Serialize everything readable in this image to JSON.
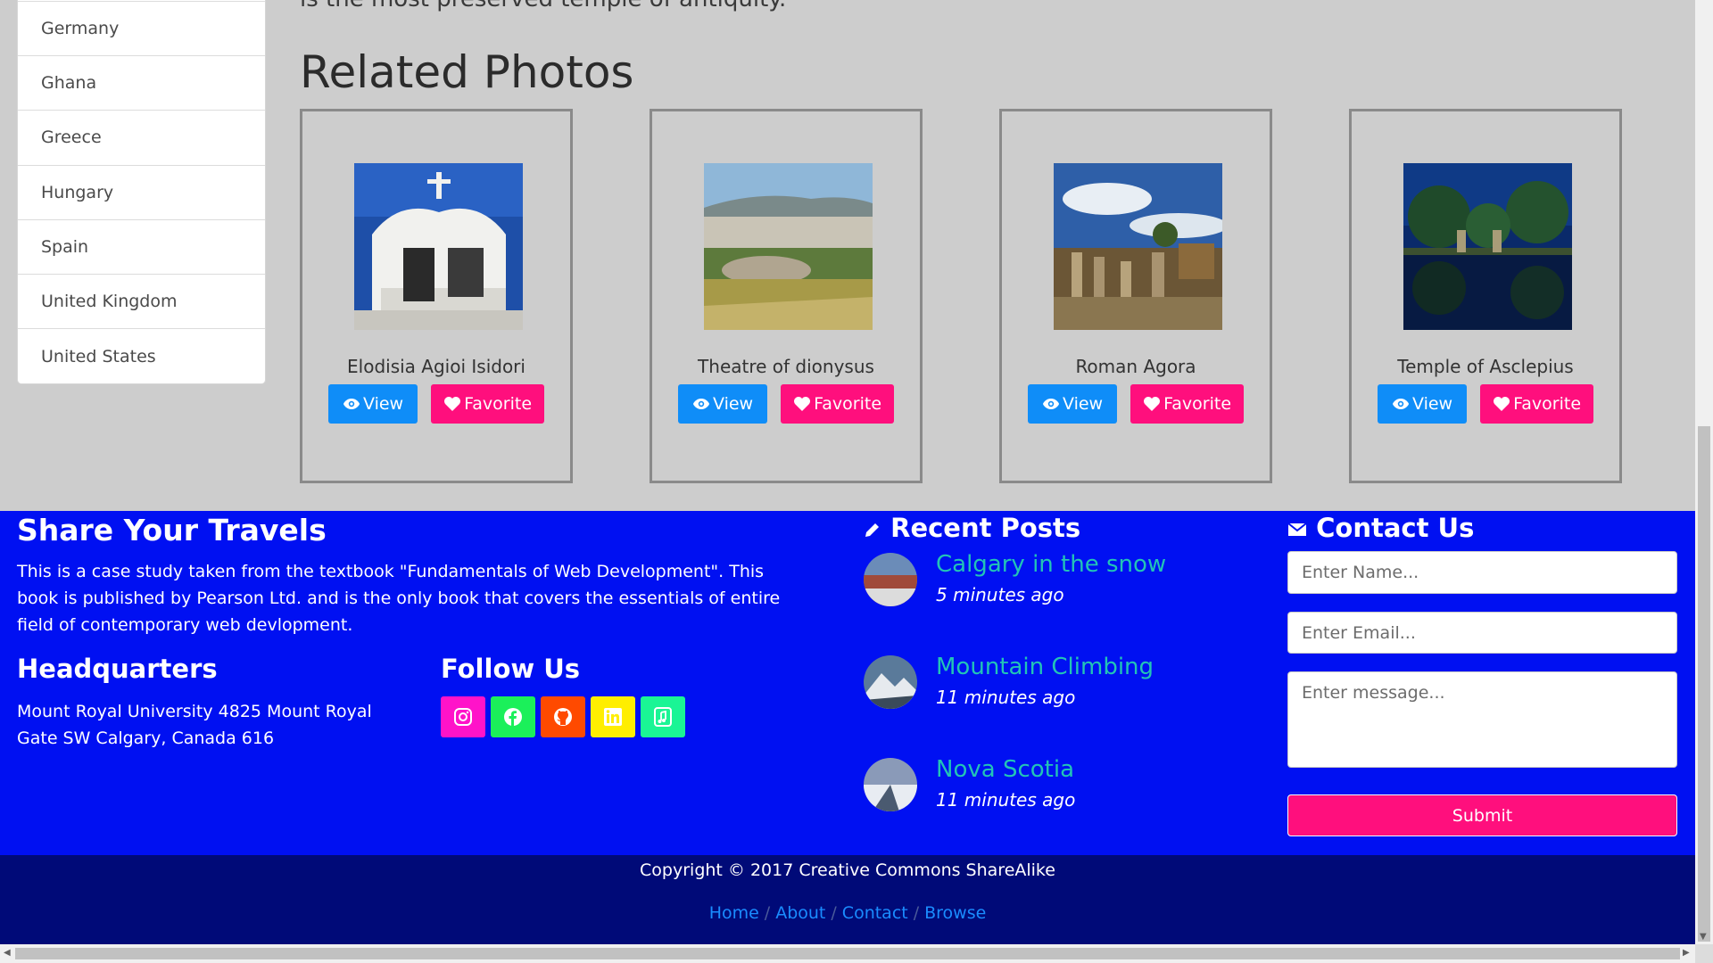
{
  "countries": [
    "Germany",
    "Ghana",
    "Greece",
    "Hungary",
    "Spain",
    "United Kingdom",
    "United States"
  ],
  "intro_tail": "is the most preserved temple of antiquity.",
  "related_title": "Related Photos",
  "view_label": "View",
  "favorite_label": "Favorite",
  "photos": [
    {
      "title": "Elodisia Agioi Isidori"
    },
    {
      "title": "Theatre of dionysus"
    },
    {
      "title": "Roman Agora"
    },
    {
      "title": "Temple of Asclepius"
    }
  ],
  "footer": {
    "share_title": "Share Your Travels",
    "share_text": "This is a case study taken from the textbook \"Fundamentals of Web Development\". This book is published by Pearson Ltd. and is the only book that covers the essentials of entire field of contemporary web devlopment.",
    "hq_title": "Headquarters",
    "hq_text": "Mount Royal University 4825 Mount Royal Gate SW Calgary, Canada 616",
    "follow_title": "Follow Us",
    "social": [
      {
        "name": "instagram",
        "color": "#ff13c9"
      },
      {
        "name": "facebook",
        "color": "#1bf05a"
      },
      {
        "name": "github",
        "color": "#ff4a00"
      },
      {
        "name": "linkedin",
        "color": "#ffee00"
      },
      {
        "name": "music",
        "color": "#1af595"
      }
    ],
    "recent_title": "Recent Posts",
    "posts": [
      {
        "title": "Calgary in the snow",
        "meta": "5 minutes ago"
      },
      {
        "title": "Mountain Climbing",
        "meta": "11 minutes ago"
      },
      {
        "title": "Nova Scotia",
        "meta": "11 minutes ago"
      }
    ],
    "contact_title": "Contact Us",
    "name_placeholder": "Enter Name...",
    "email_placeholder": "Enter Email...",
    "message_placeholder": "Enter message...",
    "submit_label": "Submit",
    "copyright": "Copyright © 2017 Creative Commons ShareAlike",
    "nav": [
      "Home",
      "About",
      "Contact",
      "Browse"
    ]
  },
  "colors": {
    "view_button": "#0f8df8",
    "favorite_button": "#ff0f7d",
    "footer_blue": "#0010f2",
    "footer_dark": "#000a78",
    "post_link": "#22c4b6"
  }
}
